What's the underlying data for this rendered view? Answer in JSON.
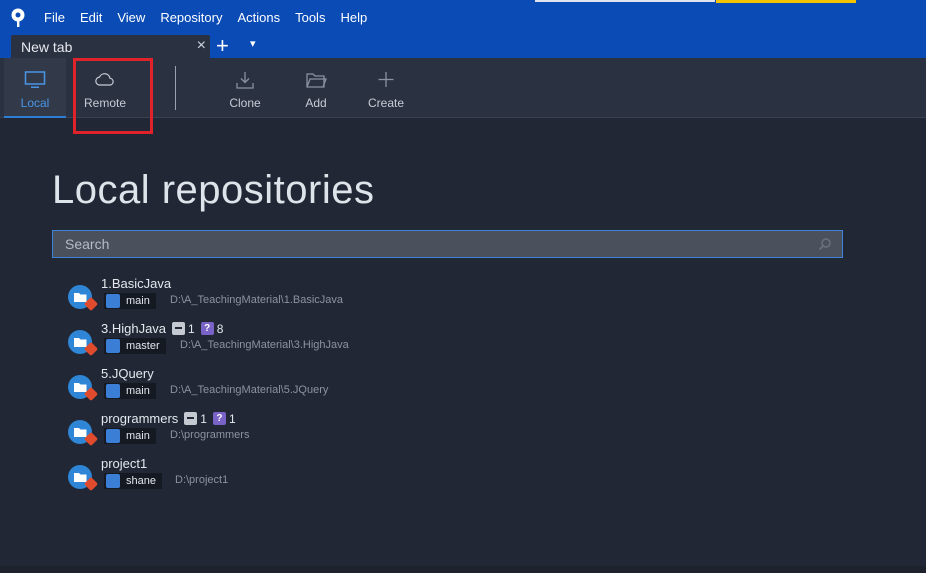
{
  "menu": [
    "File",
    "Edit",
    "View",
    "Repository",
    "Actions",
    "Tools",
    "Help"
  ],
  "tab": {
    "label": "New tab",
    "close": "×",
    "add": "+",
    "dropdown": "▾"
  },
  "toolbar": {
    "local": "Local",
    "remote": "Remote",
    "clone": "Clone",
    "add": "Add",
    "create": "Create"
  },
  "main": {
    "heading": "Local repositories",
    "search_placeholder": "Search"
  },
  "repos": [
    {
      "name": "1.BasicJava",
      "branch": "main",
      "path": "D:\\A_TeachingMaterial\\1.BasicJava",
      "removed": null,
      "untracked": null
    },
    {
      "name": "3.HighJava",
      "branch": "master",
      "path": "D:\\A_TeachingMaterial\\3.HighJava",
      "removed": "1",
      "untracked": "8"
    },
    {
      "name": "5.JQuery",
      "branch": "main",
      "path": "D:\\A_TeachingMaterial\\5.JQuery",
      "removed": null,
      "untracked": null
    },
    {
      "name": "programmers",
      "branch": "main",
      "path": "D:\\programmers",
      "removed": "1",
      "untracked": "1"
    },
    {
      "name": "project1",
      "branch": "shane",
      "path": "D:\\project1",
      "removed": null,
      "untracked": null
    }
  ],
  "colors": {
    "titlebar": "#0a4bb5",
    "background": "#212734",
    "accent": "#2d7dd2",
    "highlight": "#e0232b"
  }
}
